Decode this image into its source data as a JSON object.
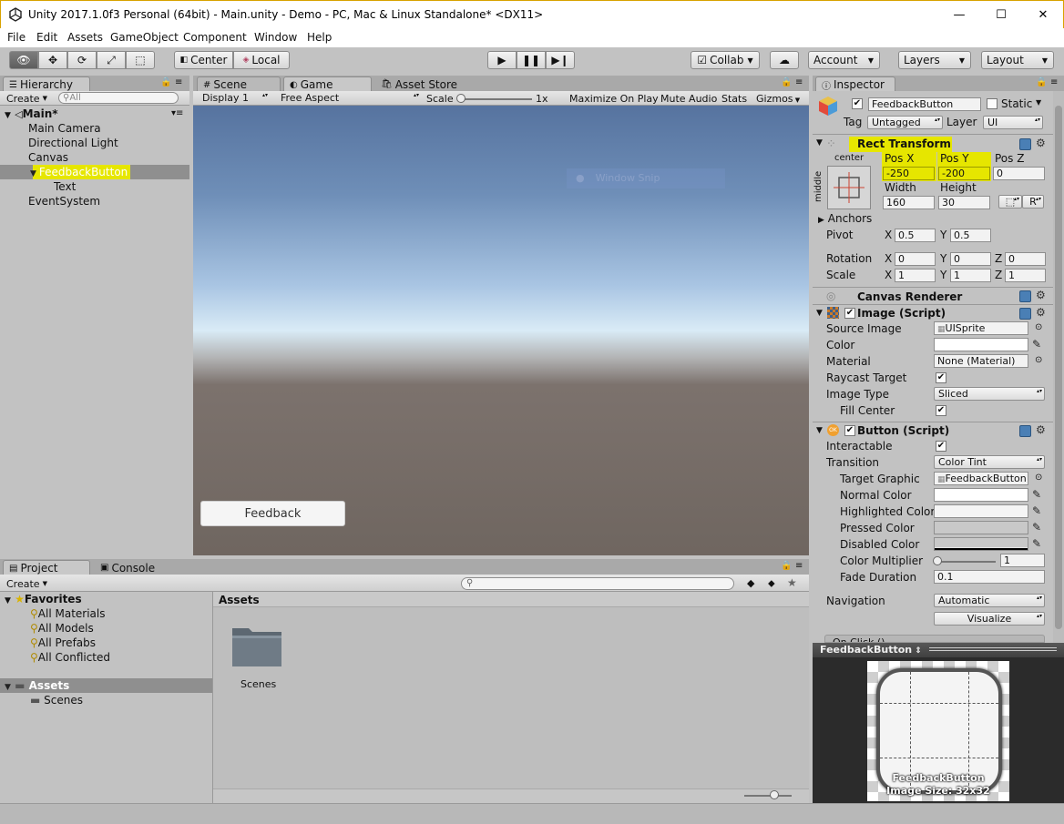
{
  "window": {
    "title": "Unity 2017.1.0f3 Personal (64bit) - Main.unity - Demo - PC, Mac & Linux Standalone* <DX11>"
  },
  "menu": [
    "File",
    "Edit",
    "Assets",
    "GameObject",
    "Component",
    "Window",
    "Help"
  ],
  "toolbar": {
    "center": "Center",
    "local": "Local",
    "collab": "Collab",
    "account": "Account",
    "layers": "Layers",
    "layout": "Layout"
  },
  "hierarchy": {
    "tab": "Hierarchy",
    "create": "Create",
    "search_placeholder": "All",
    "scene": "Main*",
    "items": [
      "Main Camera",
      "Directional Light",
      "Canvas",
      "FeedbackButton",
      "Text",
      "EventSystem"
    ]
  },
  "game_view": {
    "tabs": {
      "scene": "Scene",
      "game": "Game",
      "store": "Asset Store"
    },
    "display": "Display 1",
    "aspect": "Free Aspect",
    "scale_label": "Scale",
    "scale_value": "1x",
    "maximize": "Maximize On Play",
    "mute": "Mute Audio",
    "stats": "Stats",
    "gizmos": "Gizmos",
    "button_text": "Feedback",
    "snip_label": "Window Snip"
  },
  "project": {
    "tab_project": "Project",
    "tab_console": "Console",
    "create": "Create",
    "favorites_label": "Favorites",
    "favorites": [
      "All Materials",
      "All Models",
      "All Prefabs",
      "All Conflicted"
    ],
    "assets_label": "Assets",
    "assets_children": [
      "Scenes"
    ],
    "breadcrumb": "Assets",
    "folder_name": "Scenes"
  },
  "inspector": {
    "tab": "Inspector",
    "object_name": "FeedbackButton",
    "static_label": "Static",
    "tag_label": "Tag",
    "tag_value": "Untagged",
    "layer_label": "Layer",
    "layer_value": "UI",
    "rect_transform": {
      "title": "Rect Transform",
      "anchor_top": "center",
      "anchor_side": "middle",
      "pos_x_label": "Pos X",
      "pos_y_label": "Pos Y",
      "pos_z_label": "Pos Z",
      "pos_x": "-250",
      "pos_y": "-200",
      "pos_z": "0",
      "width_label": "Width",
      "height_label": "Height",
      "width": "160",
      "height": "30",
      "r_button": "R",
      "anchors_label": "Anchors",
      "pivot_label": "Pivot",
      "pivot_x": "0.5",
      "pivot_y": "0.5",
      "rotation_label": "Rotation",
      "rot_x": "0",
      "rot_y": "0",
      "rot_z": "0",
      "scale_label": "Scale",
      "scale_x": "1",
      "scale_y": "1",
      "scale_z": "1",
      "x": "X",
      "y": "Y",
      "z": "Z"
    },
    "canvas_renderer": {
      "title": "Canvas Renderer"
    },
    "image": {
      "title": "Image (Script)",
      "source_image_label": "Source Image",
      "source_image": "UISprite",
      "color_label": "Color",
      "material_label": "Material",
      "material": "None (Material)",
      "raycast_label": "Raycast Target",
      "image_type_label": "Image Type",
      "image_type": "Sliced",
      "fill_center_label": "Fill Center"
    },
    "button": {
      "title": "Button (Script)",
      "interactable_label": "Interactable",
      "transition_label": "Transition",
      "transition": "Color Tint",
      "target_graphic_label": "Target Graphic",
      "target_graphic": "FeedbackButton",
      "normal_color_label": "Normal Color",
      "highlighted_color_label": "Highlighted Color",
      "pressed_color_label": "Pressed Color",
      "disabled_color_label": "Disabled Color",
      "color_multiplier_label": "Color Multiplier",
      "color_multiplier": "1",
      "fade_duration_label": "Fade Duration",
      "fade_duration": "0.1",
      "navigation_label": "Navigation",
      "navigation": "Automatic",
      "visualize": "Visualize",
      "onclick_label": "On Click ()"
    },
    "preview": {
      "title": "FeedbackButton",
      "caption_name": "FeedbackButton",
      "caption_size": "Image Size: 32x32"
    }
  },
  "colors": {
    "highlight": "#e6e600",
    "selection": "#8f8f8f",
    "accent_blue": "#3e7bd1"
  }
}
